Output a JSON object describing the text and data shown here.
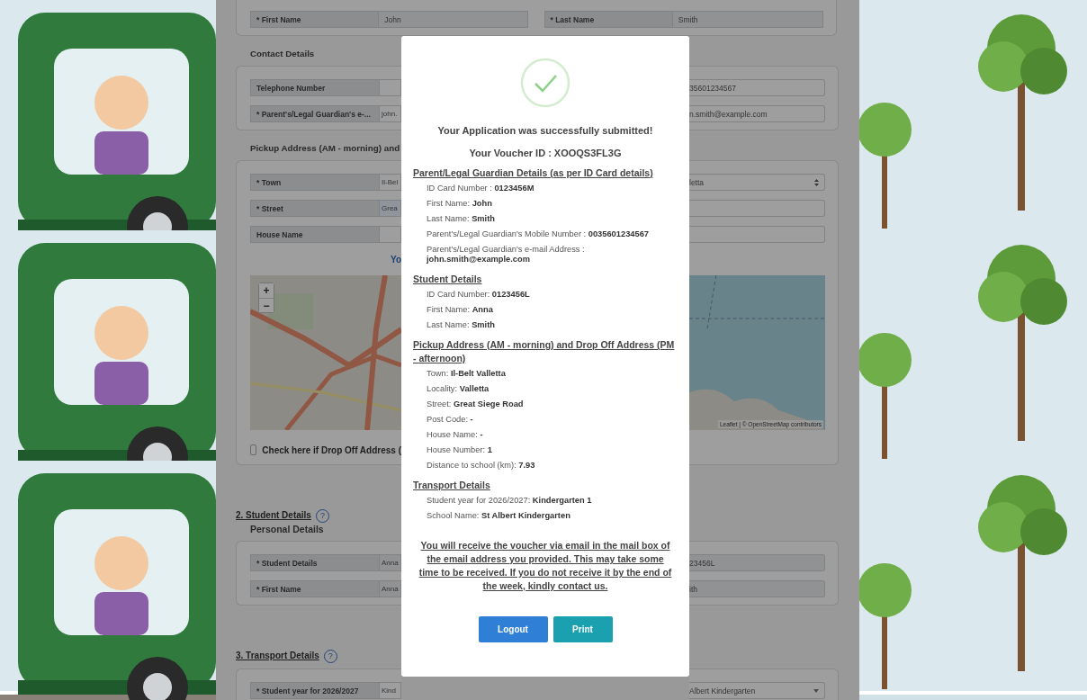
{
  "form": [
    {
      "kind": "wide_card",
      "rows": [
        {
          "label": "* First Name",
          "value": "John",
          "kind": "readonly",
          "right": {
            "label": "* Last Name",
            "value": "Smith",
            "kind": "readonly"
          }
        }
      ]
    },
    {
      "kind": "heading",
      "text": "Contact Details"
    },
    {
      "kind": "card",
      "rows": [
        {
          "label": "Telephone Number",
          "kind": "input",
          "right": {
            "value": "35601234567",
            "kind": "input"
          }
        },
        {
          "label": "* Parent's/Legal Guardian's e-...",
          "value": "john.",
          "kind": "input",
          "right": {
            "value": "n.smith@example.com",
            "kind": "input"
          }
        }
      ]
    },
    {
      "kind": "heading",
      "text": "Pickup Address (AM - morning) and"
    },
    {
      "kind": "card",
      "rows": [
        {
          "label": "* Town",
          "value": "Il-Bel",
          "kind": "input",
          "right": {
            "value": "letta",
            "kind": "select"
          }
        },
        {
          "label": "* Street",
          "value": "Grea",
          "kind": "autofill",
          "right": {
            "kind": "input"
          }
        },
        {
          "label": "House Name",
          "kind": "input",
          "right": {
            "kind": "input"
          }
        }
      ],
      "link": "Yo",
      "map": {
        "zoom_in": "+",
        "zoom_out": "−",
        "attribution": "Leaflet | © OpenStreetMap contributors"
      },
      "checkbox": {
        "label": "Check here if Drop Off Address (",
        "checked": false
      }
    },
    {
      "kind": "section_title",
      "text": "2. Student Details",
      "help": "?"
    },
    {
      "kind": "subheading",
      "text": "Personal Details"
    },
    {
      "kind": "card",
      "rows": [
        {
          "label": "* Student Details",
          "value": "Anna",
          "kind": "readonly",
          "right": {
            "value": "23456L",
            "kind": "readonly"
          }
        },
        {
          "label": "* First Name",
          "value": "Anna",
          "kind": "readonly",
          "right": {
            "value": "ith",
            "kind": "readonly"
          }
        }
      ]
    },
    {
      "kind": "section_title",
      "text": "3. Transport Details",
      "help": "?"
    },
    {
      "kind": "card",
      "rows": [
        {
          "label": "* Student year for 2026/2027",
          "value": "Kind",
          "kind": "input",
          "right": {
            "value": "Albert Kindergarten",
            "kind": "dropdown"
          }
        }
      ]
    }
  ],
  "modal": {
    "title": "Your Application was successfully submitted!",
    "voucher": "Your Voucher ID : XOOQS3FL3G",
    "sections": [
      {
        "heading": "Parent/Legal Guardian Details (as per ID Card details)",
        "items": [
          "ID Card Number : **0123456M**",
          "First Name: **John**",
          "Last Name: **Smith**",
          "Parent's/Legal Guardian's Mobile Number : **0035601234567**",
          "Parent's/Legal Guardian's e-mail Address : **john.smith@example.com**"
        ]
      },
      {
        "heading": "Student Details",
        "items": [
          "ID Card Number: **0123456L**",
          "First Name: **Anna**",
          "Last Name: **Smith**"
        ]
      },
      {
        "heading": "Pickup Address (AM - morning) and Drop Off Address (PM - afternoon)",
        "items": [
          "Town: **Il-Belt Valletta**",
          "Locality: **Valletta**",
          "Street: **Great Siege Road**",
          "Post Code: **-**",
          "House Name: **-**",
          "House Number: **1**",
          "Distance to school (km): **7.93**"
        ]
      },
      {
        "heading": "Transport Details",
        "items": [
          "Student year for 2026/2027: **Kindergarten 1**",
          "School Name: **St Albert Kindergarten**"
        ]
      }
    ],
    "notice": "You will receive the voucher via email in the mail box of the email address you provided. This may take some time to be received. If you do not receive it by the end of the week, kindly contact us.",
    "buttons": [
      {
        "label": "Logout",
        "kind": "primary"
      },
      {
        "label": "Print",
        "kind": "info"
      }
    ]
  }
}
